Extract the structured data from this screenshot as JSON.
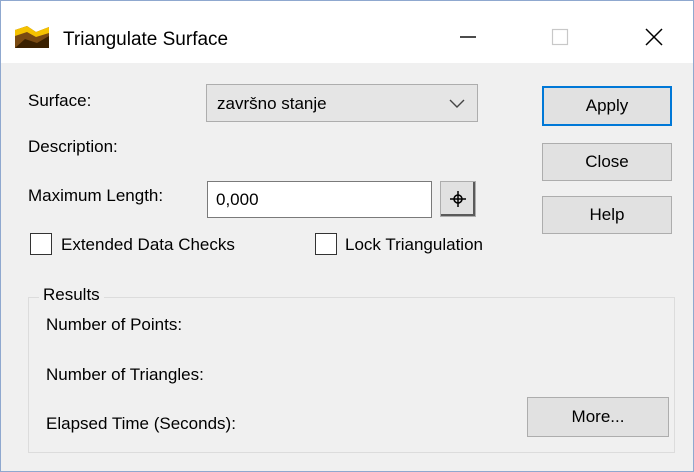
{
  "window": {
    "title": "Triangulate Surface",
    "icon": "surface-app-icon",
    "controls": {
      "minimize_icon": "minimize-icon",
      "maximize_icon": "maximize-icon",
      "close_icon": "close-icon"
    }
  },
  "form": {
    "surface_label": "Surface:",
    "surface_value": "završno stanje",
    "description_label": "Description:",
    "max_length_label": "Maximum Length:",
    "max_length_value": "0,000",
    "pick_icon": "crosshair-icon",
    "extended_checks_label": "Extended Data Checks",
    "extended_checks_checked": false,
    "lock_triangulation_label": "Lock Triangulation",
    "lock_triangulation_checked": false
  },
  "buttons": {
    "apply": "Apply",
    "close": "Close",
    "help": "Help",
    "more": "More..."
  },
  "results": {
    "legend": "Results",
    "points_label": "Number of Points:",
    "triangles_label": "Number of Triangles:",
    "elapsed_label": "Elapsed Time (Seconds):"
  },
  "colors": {
    "default_button_border": "#0078d7",
    "window_border": "#8fa8cf",
    "dialog_background": "#f0f0f0"
  }
}
